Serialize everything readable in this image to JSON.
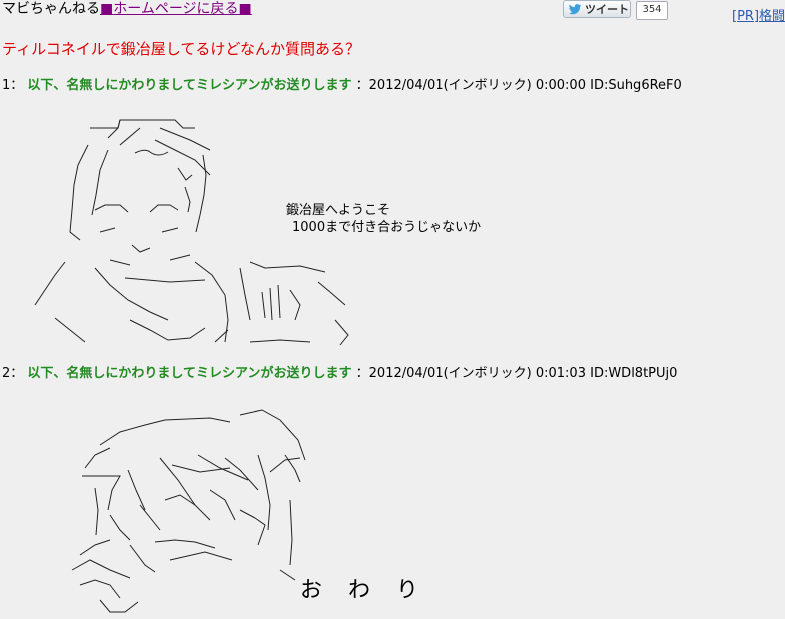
{
  "header": {
    "site_name": "マビちゃんねる",
    "home_link": "ホームページに戻る",
    "square": "■",
    "tweet_label": "ツイート",
    "tweet_count": "354",
    "pr_link": "[PR]格闘"
  },
  "thread": {
    "title": "ティルコネイルで鍛冶屋してるけどなんか質問ある？"
  },
  "posts": [
    {
      "number": "1：",
      "name": "以下、名無しにかわりましてミレシアンがお送りします",
      "meta": "：2012/04/01(インボリック) 0:00:00 ID:Suhg6ReF0",
      "lines": [
        "鍛冶屋へようこそ",
        "1000まで付き合おうじゃないか"
      ]
    },
    {
      "number": "2：",
      "name": "以下、名無しにかわりましてミレシアンがお送りします",
      "meta": "：2012/04/01(インボリック) 0:01:03 ID:WDl8tPUj0",
      "lines": [
        "お　わ　り"
      ]
    }
  ],
  "colors": {
    "background": "#efefef",
    "title": "#e00000",
    "name": "#228b22",
    "link": "#800080",
    "pr": "#2b5cb0"
  }
}
